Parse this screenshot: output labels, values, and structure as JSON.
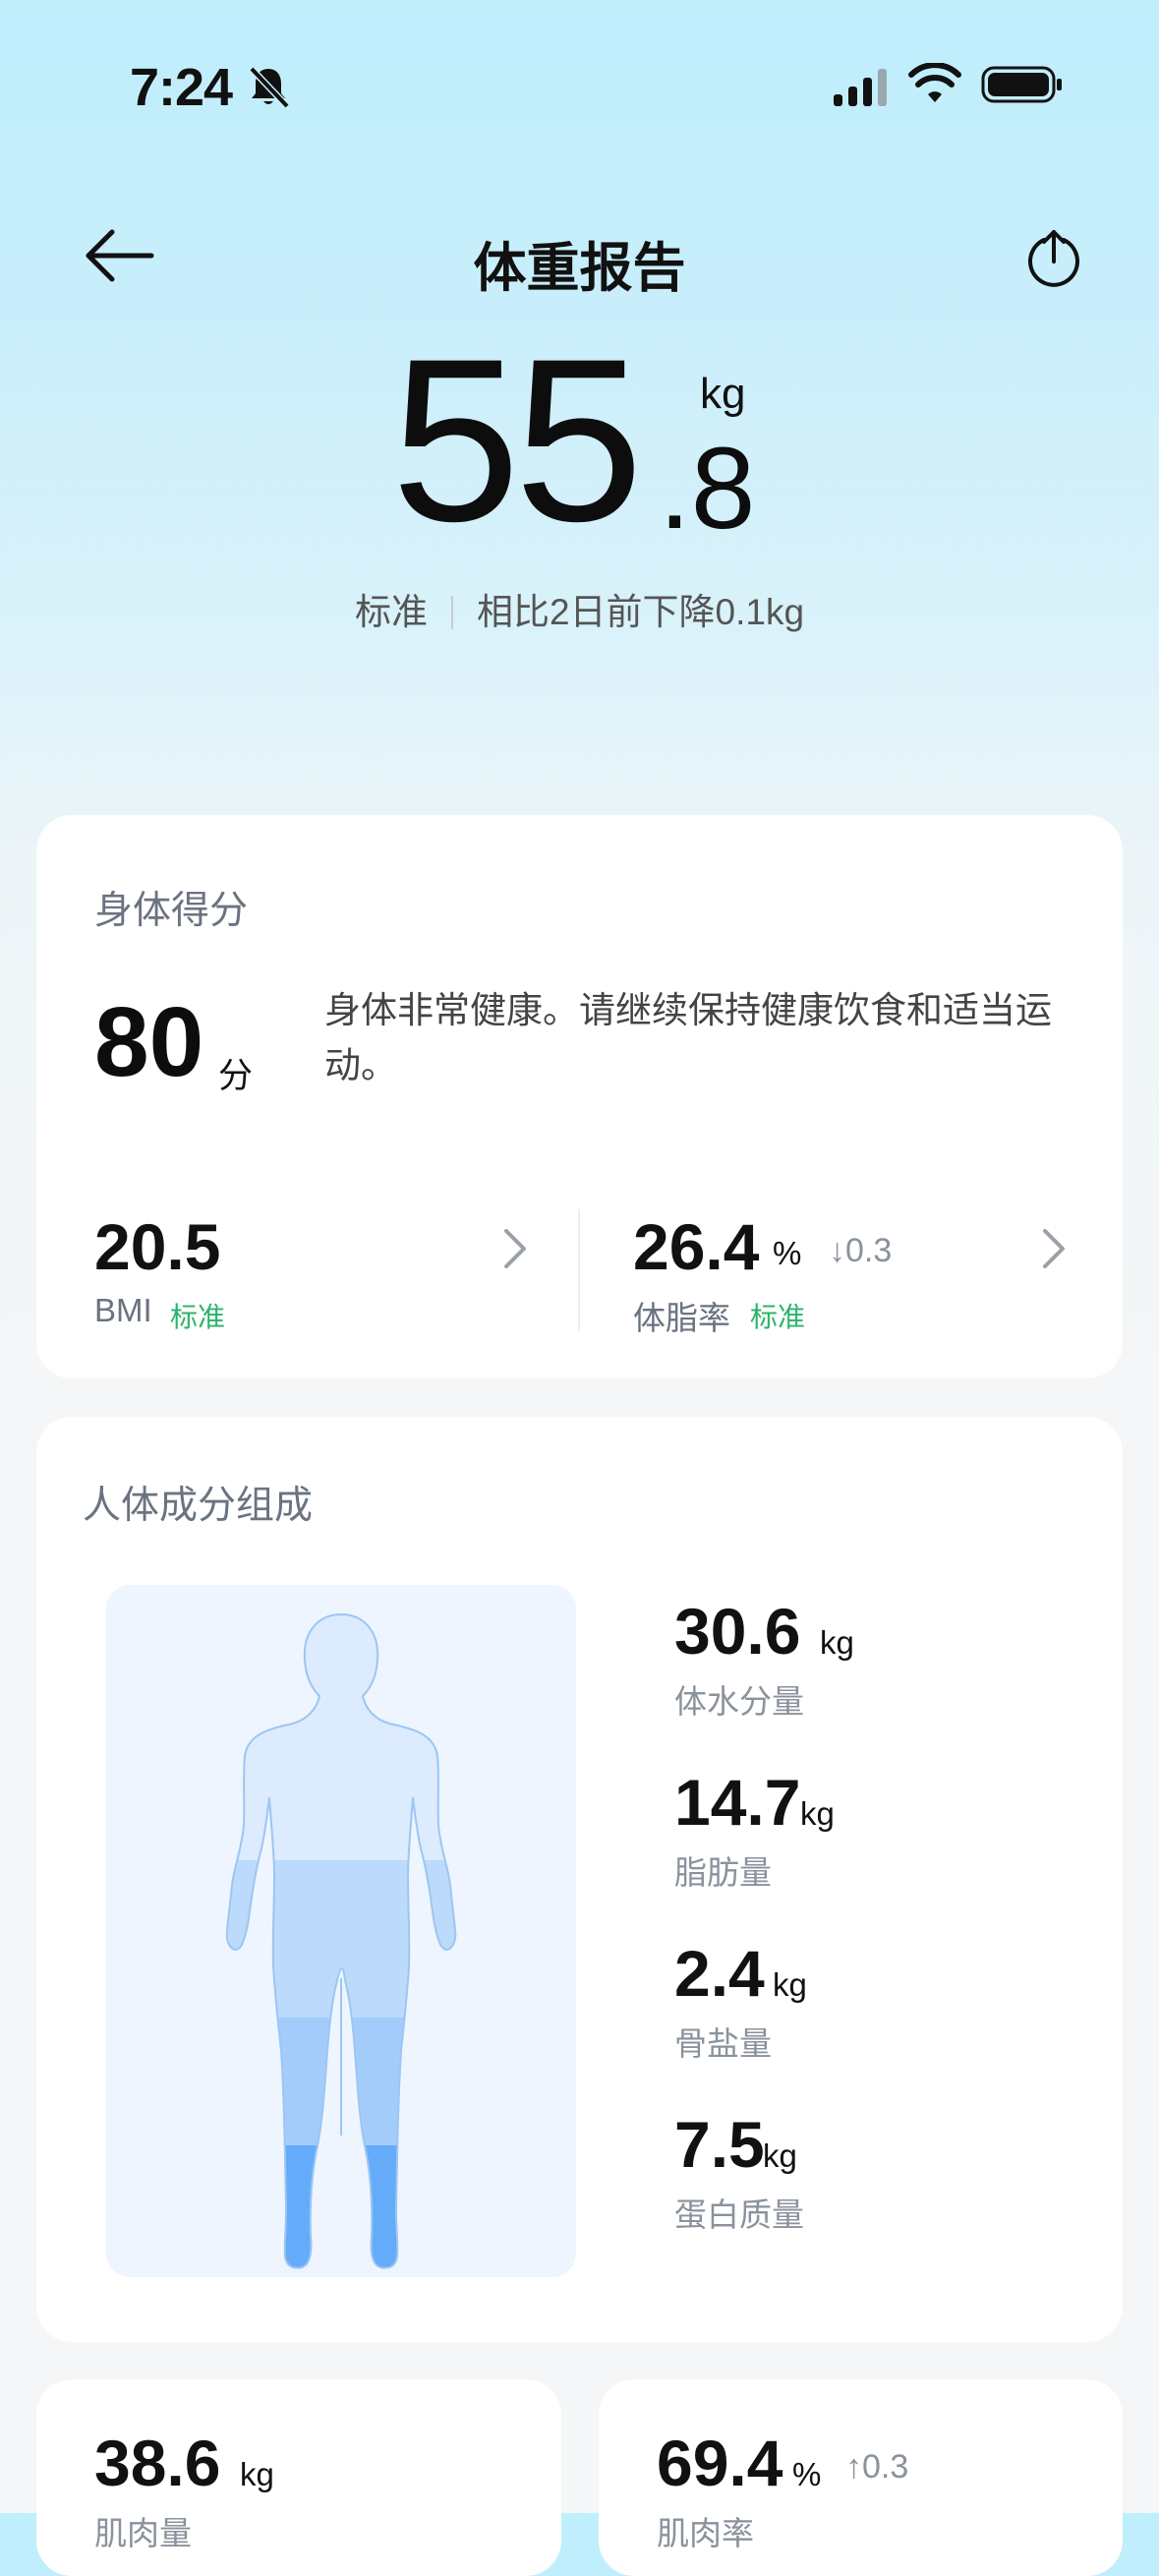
{
  "status_bar": {
    "time": "7:24",
    "icons": [
      "bell-muted-icon",
      "signal-icon",
      "wifi-icon",
      "battery-icon"
    ]
  },
  "header": {
    "title": "体重报告",
    "back_icon": "arrow-left-icon",
    "share_icon": "share-icon"
  },
  "weight": {
    "integer": "55",
    "decimal": ".8",
    "unit": "kg",
    "status": "标准",
    "change": "相比2日前下降0.1kg"
  },
  "score_card": {
    "title": "身体得分",
    "score": "80",
    "score_unit": "分",
    "description": "身体非常健康。请继续保持健康饮食和适当运动。",
    "bmi": {
      "value": "20.5",
      "label": "BMI",
      "status": "标准"
    },
    "body_fat": {
      "value": "26.4",
      "unit": "%",
      "trend": "↓0.3",
      "label": "体脂率",
      "status": "标准"
    }
  },
  "composition": {
    "title": "人体成分组成",
    "items": [
      {
        "value": "30.6",
        "unit": "kg",
        "label": "体水分量"
      },
      {
        "value": "14.7",
        "unit": "kg",
        "label": "脂肪量"
      },
      {
        "value": "2.4",
        "unit": "kg",
        "label": "骨盐量"
      },
      {
        "value": "7.5",
        "unit": "kg",
        "label": "蛋白质量"
      }
    ]
  },
  "bottom_cards": {
    "left": {
      "value": "38.6",
      "unit": "kg",
      "label": "肌肉量"
    },
    "right": {
      "value": "69.4",
      "unit": "%",
      "trend": "↑0.3",
      "label": "肌肉率"
    }
  },
  "colors": {
    "accent_green": "#2bb36a",
    "body_light": "#dcebfd",
    "body_mid": "#b4d5fb",
    "body_dark": "#64acf9"
  }
}
